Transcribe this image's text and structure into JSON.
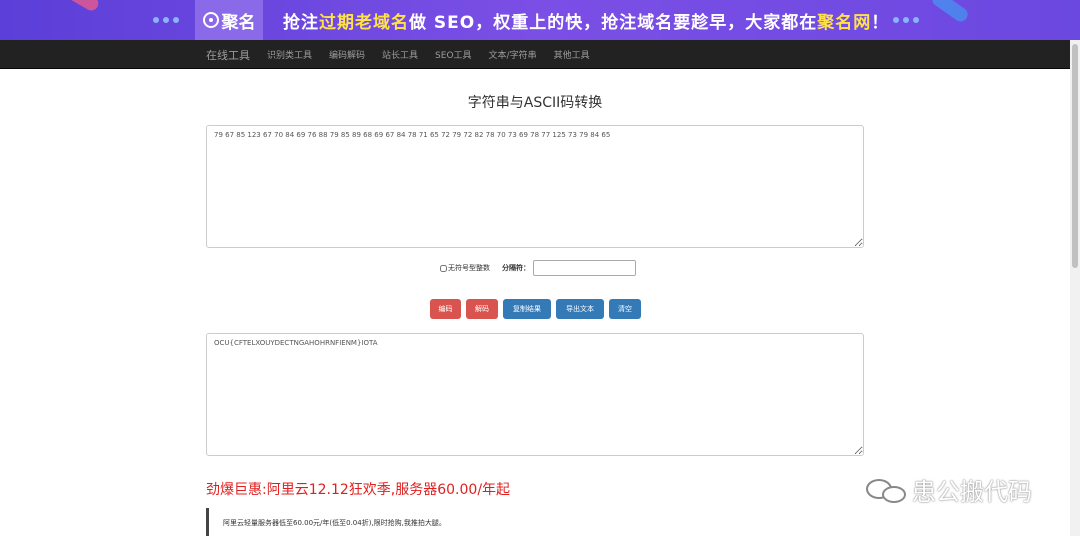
{
  "banner": {
    "logo_text": "聚名",
    "slogan_pre": "抢注",
    "slogan_hl1": "过期老域名",
    "slogan_mid": "做 SEO，权重上的快，抢注域名要趁早，大家都在",
    "slogan_hl2": "聚名网",
    "slogan_end": "！"
  },
  "nav": {
    "brand": "在线工具",
    "items": [
      "识别类工具",
      "编码解码",
      "站长工具",
      "SEO工具",
      "文本/字符串",
      "其他工具"
    ]
  },
  "page": {
    "title": "字符串与ASCII码转换"
  },
  "input": {
    "value": "79 67 85 123 67 70 84 69 76 88 79 85 89 68 69 67 84 78 71 65 72 79 72 82 78 70 73 69 78 77 125 73 79 84 65"
  },
  "options": {
    "unsigned_label": "无符号型整数",
    "separator_label": "分隔符：",
    "separator_value": ""
  },
  "buttons": {
    "encode": "编码",
    "decode": "解码",
    "copy": "复制结果",
    "export": "导出文本",
    "clear": "清空"
  },
  "output": {
    "value": "OCU{CFTELXOUYDECTNGAHOHRNFIENM}IOTA"
  },
  "promo": {
    "title": "劲爆巨惠:阿里云12.12狂欢季,服务器60.00/年起",
    "text": "阿里云轻量服务器低至60.00元/年(低至0.04折),限时抢购,我推拍大腿。"
  },
  "watermark": {
    "text": "患公搬代码"
  },
  "colors": {
    "banner_bg": "#6b48e0",
    "nav_bg": "#222222",
    "btn_red": "#d9534f",
    "btn_blue": "#337ab7",
    "promo_red": "#e02020"
  }
}
